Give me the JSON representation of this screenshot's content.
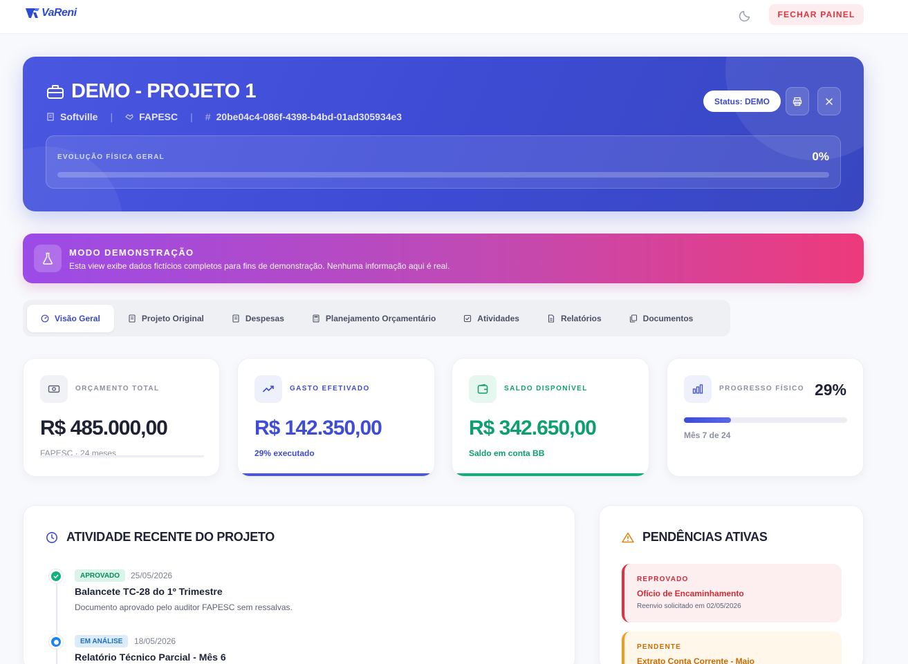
{
  "app": {
    "logo_text": "VaReni",
    "close_panel_label": "FECHAR PAINEL"
  },
  "hero": {
    "title": "DEMO - PROJETO 1",
    "company": "Softville",
    "funder": "FAPESC",
    "project_id": "20be04c4-086f-4398-b4bd-01ad305934e3",
    "status_label": "Status: DEMO",
    "progress_label": "EVOLUÇÃO FÍSICA GERAL",
    "progress_value": "0%",
    "progress_fraction": 0
  },
  "demo_banner": {
    "title": "MODO DEMONSTRAÇÃO",
    "text": "Esta view exibe dados fictícios completos para fins de demonstração. Nenhuma informação aqui é real."
  },
  "tabs": [
    {
      "label": "Visão Geral",
      "icon": "dashboard-icon",
      "active": true
    },
    {
      "label": "Projeto Original",
      "icon": "document-icon",
      "active": false
    },
    {
      "label": "Despesas",
      "icon": "receipt-icon",
      "active": false
    },
    {
      "label": "Planejamento Orçamentário",
      "icon": "calculator-icon",
      "active": false
    },
    {
      "label": "Atividades",
      "icon": "checkbox-icon",
      "active": false
    },
    {
      "label": "Relatórios",
      "icon": "report-icon",
      "active": false
    },
    {
      "label": "Documentos",
      "icon": "files-icon",
      "active": false
    }
  ],
  "stats": {
    "budget": {
      "label": "ORÇAMENTO TOTAL",
      "value": "R$ 485.000,00",
      "sub": "FAPESC · 24 meses"
    },
    "spent": {
      "label": "GASTO EFETIVADO",
      "value": "R$ 142.350,00",
      "sub": "29% executado"
    },
    "balance": {
      "label": "SALDO DISPONÍVEL",
      "value": "R$ 342.650,00",
      "sub": "Saldo em conta BB"
    },
    "progress": {
      "label": "PROGRESSO FÍSICO",
      "value": "29%",
      "sub": "Mês 7 de 24",
      "fraction": 0.29
    }
  },
  "activity": {
    "title": "ATIVIDADE RECENTE DO PROJETO",
    "items": [
      {
        "badge": "APROVADO",
        "date": "25/05/2026",
        "title": "Balancete TC-28 do 1º Trimestre",
        "desc": "Documento aprovado pelo auditor FAPESC sem ressalvas."
      },
      {
        "badge": "EM ANÁLISE",
        "date": "18/05/2026",
        "title": "Relatório Técnico Parcial - Mês 6",
        "desc": ""
      }
    ]
  },
  "pending": {
    "title": "PENDÊNCIAS ATIVAS",
    "items": [
      {
        "label": "REPROVADO",
        "title": "Ofício de Encaminhamento",
        "desc": "Reenvio solicitado em 02/05/2026"
      },
      {
        "label": "PENDENTE",
        "title": "Extrato Conta Corrente - Maio",
        "desc": ""
      }
    ]
  },
  "colors": {
    "primary": "#3e4cd6",
    "green": "#0e9f6e",
    "red": "#e0323f",
    "orange": "#e8820c"
  }
}
